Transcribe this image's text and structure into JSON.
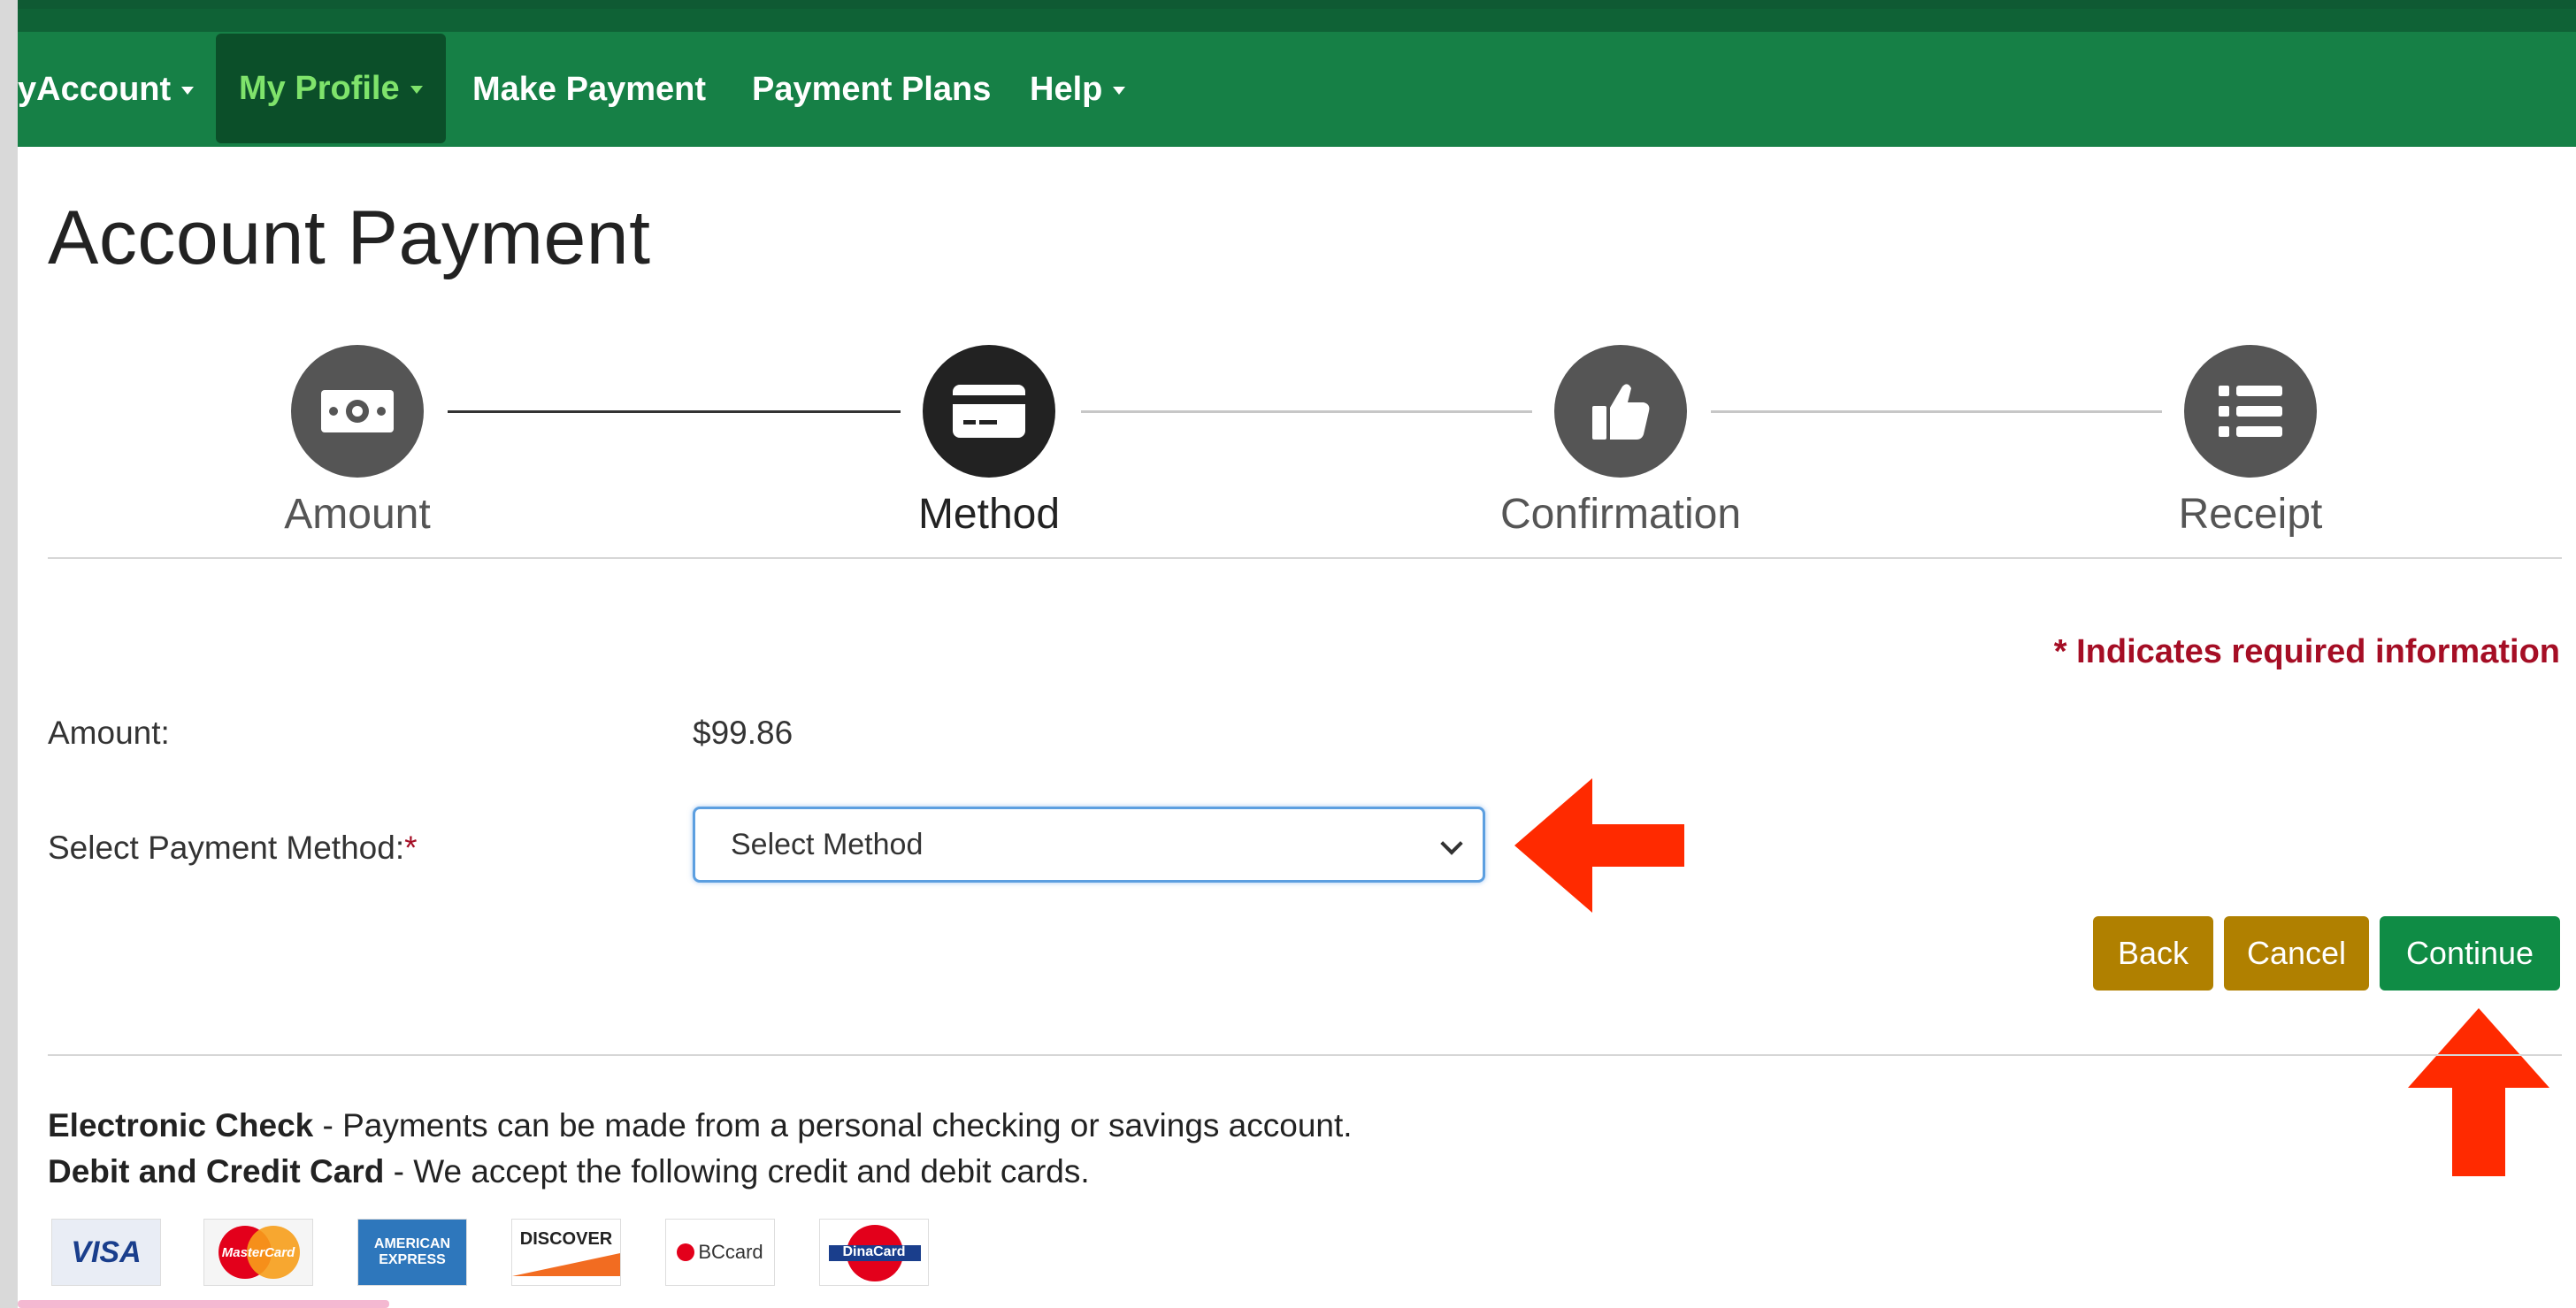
{
  "nav": {
    "items": [
      {
        "label": "Account",
        "prefix": "y "
      },
      {
        "label": "My Profile"
      },
      {
        "label": "Make Payment"
      },
      {
        "label": "Payment Plans"
      },
      {
        "label": "Help"
      }
    ]
  },
  "page_title": "Account Payment",
  "stepper": {
    "steps": [
      {
        "label": "Amount",
        "icon": "money-bill-icon"
      },
      {
        "label": "Method",
        "icon": "credit-card-icon"
      },
      {
        "label": "Confirmation",
        "icon": "thumbs-up-icon"
      },
      {
        "label": "Receipt",
        "icon": "list-icon"
      }
    ],
    "current_step": "Method"
  },
  "form": {
    "required_note": "* Indicates required information",
    "amount_label": "Amount:",
    "amount_value": "$99.86",
    "method_label": "Select Payment Method:",
    "method_required_mark": "*",
    "method_selected": "Select Method"
  },
  "buttons": {
    "back": "Back",
    "cancel": "Cancel",
    "continue": "Continue"
  },
  "info": {
    "echeck_title": "Electronic Check",
    "echeck_text": " - Payments can be made from a personal checking or savings account.",
    "card_title": "Debit and Credit Card",
    "card_text": " - We accept the following credit and debit cards."
  },
  "cards": [
    {
      "label": "VISA"
    },
    {
      "label": "MasterCard"
    },
    {
      "label": "AMERICAN EXPRESS"
    },
    {
      "label": "DISCOVER"
    },
    {
      "label": "BCcard"
    },
    {
      "label": "DinaCard"
    }
  ],
  "colors": {
    "nav_green": "#168046",
    "active_text": "#7fe36b",
    "required_red": "#a50e25",
    "gold_button": "#b08000",
    "continue_green": "#0f8c45",
    "annotation_arrow": "#ff2a00"
  }
}
